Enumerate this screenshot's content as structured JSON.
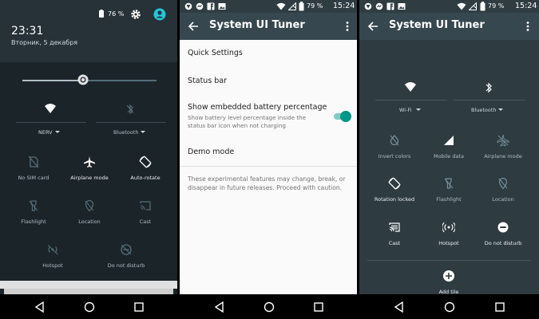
{
  "panel1": {
    "status": {
      "battery": "76 %"
    },
    "time": "23:31",
    "date": "Вторник, 5 декабря",
    "brightness_level": 0.42,
    "tiles_top": [
      {
        "label": "NERV",
        "icon": "wifi-icon"
      },
      {
        "label": "Bluetooth",
        "icon": "bluetooth-icon"
      }
    ],
    "tiles": [
      {
        "label": "No SIM card",
        "icon": "sim-off-icon"
      },
      {
        "label": "Airplane mode",
        "icon": "airplane-icon"
      },
      {
        "label": "Auto-rotate",
        "icon": "rotate-icon"
      },
      {
        "label": "Flashlight",
        "icon": "flashlight-icon"
      },
      {
        "label": "Location",
        "icon": "location-icon"
      },
      {
        "label": "Cast",
        "icon": "cast-icon"
      },
      {
        "label": "Hotspot",
        "icon": "hotspot-icon"
      },
      {
        "label": "Do not disturb",
        "icon": "dnd-icon"
      }
    ]
  },
  "panel2": {
    "status": {
      "battery": "79 %",
      "time": "15:24"
    },
    "title": "System UI Tuner",
    "items": [
      {
        "label": "Quick Settings"
      },
      {
        "label": "Status bar"
      },
      {
        "label": "Show embedded battery percentage",
        "sub": "Show battery level percentage inside the status bar icon when not charging",
        "toggle": true
      },
      {
        "label": "Demo mode"
      }
    ],
    "note": "These experimental features may change, break, or disappear in future releases. Proceed with caution."
  },
  "panel3": {
    "status": {
      "battery": "79 %",
      "time": "15:24"
    },
    "title": "System UI Tuner",
    "tiles_top": [
      {
        "label": "Wi-Fi",
        "icon": "wifi-icon"
      },
      {
        "label": "Bluetooth",
        "icon": "bluetooth-icon"
      }
    ],
    "tiles": [
      {
        "label": "Invert colors",
        "icon": "invert-colors-icon"
      },
      {
        "label": "Mobile data",
        "icon": "signal-icon"
      },
      {
        "label": "Airplane mode",
        "icon": "airplane-icon"
      },
      {
        "label": "Rotation locked",
        "icon": "rotate-icon"
      },
      {
        "label": "Flashlight",
        "icon": "flashlight-icon"
      },
      {
        "label": "Location",
        "icon": "location-icon"
      },
      {
        "label": "Cast",
        "icon": "cast-icon"
      },
      {
        "label": "Hotspot",
        "icon": "hotspot-icon"
      },
      {
        "label": "Do not disturb",
        "icon": "dnd-icon"
      }
    ],
    "add_tile": "Add tile"
  }
}
